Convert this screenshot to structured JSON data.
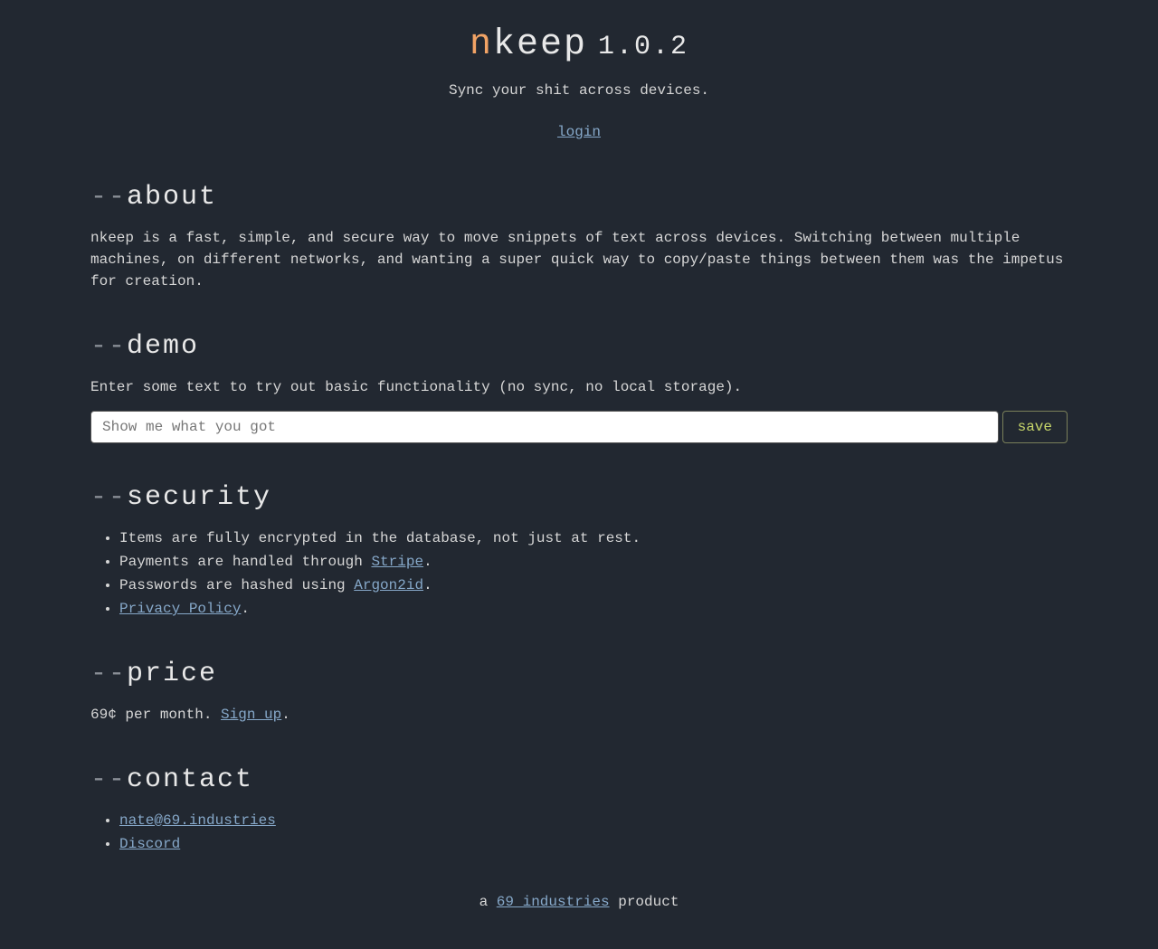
{
  "header": {
    "title_n": "n",
    "title_rest": "keep",
    "version": "1.0.2",
    "tagline": "Sync your shit across devices.",
    "login": "login"
  },
  "about": {
    "heading": "about",
    "body": "nkeep is a fast, simple, and secure way to move snippets of text across devices. Switching between multiple machines, on different networks, and wanting a super quick way to copy/paste things between them was the impetus for creation."
  },
  "demo": {
    "heading": "demo",
    "intro": "Enter some text to try out basic functionality (no sync, no local storage).",
    "placeholder": "Show me what you got",
    "save_label": "save"
  },
  "security": {
    "heading": "security",
    "item1": "Items are fully encrypted in the database, not just at rest.",
    "item2_pre": "Payments are handled through ",
    "item2_link": "Stripe",
    "item2_post": ".",
    "item3_pre": "Passwords are hashed using ",
    "item3_link": "Argon2id",
    "item3_post": ".",
    "item4_link": "Privacy Policy",
    "item4_post": "."
  },
  "price": {
    "heading": "price",
    "text_pre": "69¢ per month. ",
    "signup": "Sign up",
    "text_post": "."
  },
  "contact": {
    "heading": "contact",
    "email": "nate@69.industries",
    "discord": "Discord"
  },
  "footer": {
    "pre": "a ",
    "link": "69 industries",
    "post": " product"
  },
  "dashes": "--"
}
